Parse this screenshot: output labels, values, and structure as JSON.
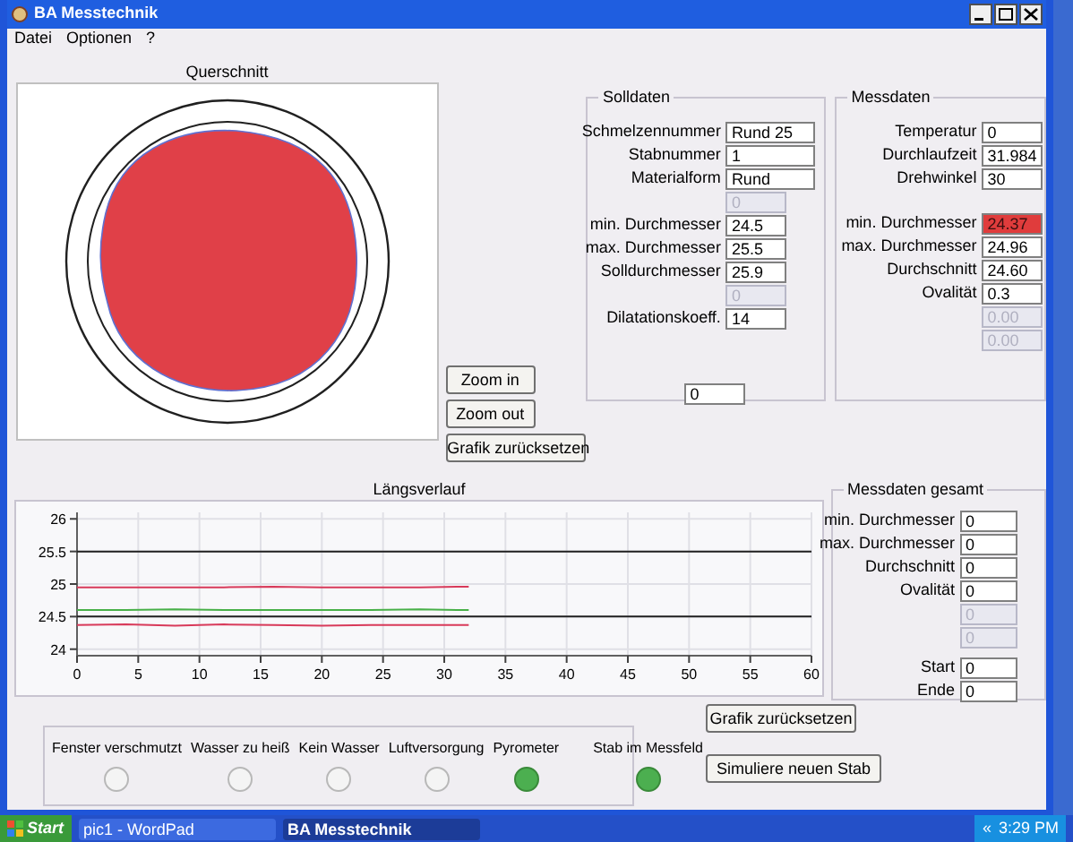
{
  "window": {
    "title": "BA Messtechnik"
  },
  "menu": [
    "Datei",
    "Optionen",
    "?"
  ],
  "cross_section": {
    "title": "Querschnitt"
  },
  "view_buttons": [
    "Zoom in",
    "Zoom out",
    "Grafik zurücksetzen"
  ],
  "solldaten": {
    "title": "Solldaten",
    "rows": [
      {
        "label": "Schmelzennummer",
        "value": "Rund 25",
        "disabled": false
      },
      {
        "label": "Stabnummer",
        "value": "1",
        "disabled": false
      },
      {
        "label": "Materialform",
        "value": "Rund",
        "disabled": false
      },
      {
        "value": "0",
        "disabled": true
      },
      {
        "label": "min. Durchmesser",
        "value": "24.5",
        "disabled": false
      },
      {
        "label": "max. Durchmesser",
        "value": "25.5",
        "disabled": false
      },
      {
        "label": "Solldurchmesser",
        "value": "25.9",
        "disabled": false
      },
      {
        "value": "0",
        "disabled": true
      },
      {
        "label": "Dilatationskoeff.",
        "value": "14",
        "disabled": false
      }
    ],
    "counter": "0"
  },
  "messdaten": {
    "title": "Messdaten",
    "sections": [
      [
        {
          "label": "Temperatur",
          "value": "0",
          "disabled": false,
          "alarm": false
        },
        {
          "label": "Durchlaufzeit",
          "value": "31.984",
          "disabled": false,
          "alarm": false
        },
        {
          "label": "Drehwinkel",
          "value": "30",
          "disabled": false,
          "alarm": false
        }
      ],
      [
        {
          "label": "min. Durchmesser",
          "value": "24.37",
          "disabled": false,
          "alarm": true
        },
        {
          "label": "max. Durchmesser",
          "value": "24.96",
          "disabled": false,
          "alarm": false
        },
        {
          "label": "Durchschnitt",
          "value": "24.60",
          "disabled": false,
          "alarm": false
        },
        {
          "label": "Ovalität",
          "value": "0.3",
          "disabled": false,
          "alarm": false
        },
        {
          "value": "0.00",
          "disabled": true,
          "alarm": false
        },
        {
          "value": "0.00",
          "disabled": true,
          "alarm": false
        }
      ]
    ]
  },
  "profile": {
    "title": "Längsverlauf",
    "chart_data": {
      "type": "line",
      "grid": true,
      "x": [
        0,
        4,
        8,
        12,
        16,
        20,
        24,
        28,
        32,
        36,
        40,
        44,
        48,
        52,
        56,
        60
      ],
      "xlim": [
        0,
        60
      ],
      "ylim": [
        23.9,
        26.1
      ],
      "xticks": [
        0,
        5,
        10,
        15,
        20,
        25,
        30,
        35,
        40,
        45,
        50,
        55,
        60
      ],
      "yticks": [
        24,
        24.5,
        25,
        25.5,
        26
      ],
      "series": [
        {
          "color": "#d83a5a",
          "values": [
            24.95,
            24.95,
            24.95,
            24.95,
            24.96,
            24.95,
            24.95,
            24.95,
            24.96,
            null,
            null,
            null,
            null,
            null,
            null,
            null
          ]
        },
        {
          "color": "#48b048",
          "values": [
            24.6,
            24.6,
            24.61,
            24.6,
            24.6,
            24.6,
            24.6,
            24.61,
            24.6,
            null,
            null,
            null,
            null,
            null,
            null,
            null
          ]
        },
        {
          "color": "#d83a5a",
          "values": [
            24.37,
            24.38,
            24.36,
            24.38,
            24.37,
            24.36,
            24.37,
            24.37,
            24.37,
            null,
            null,
            null,
            null,
            null,
            null,
            null
          ]
        },
        {
          "color": "#202020",
          "values": [
            25.5,
            25.5,
            25.5,
            25.5,
            25.5,
            25.5,
            25.5,
            25.5,
            25.5,
            25.5,
            25.5,
            25.5,
            25.5,
            25.5,
            25.5,
            25.5
          ]
        },
        {
          "color": "#202020",
          "values": [
            24.5,
            24.5,
            24.5,
            24.5,
            24.5,
            24.5,
            24.5,
            24.5,
            24.5,
            24.5,
            24.5,
            24.5,
            24.5,
            24.5,
            24.5,
            24.5
          ]
        }
      ]
    }
  },
  "messdaten_gesamt": {
    "title": "Messdaten gesamt",
    "sections": [
      [
        {
          "label": "min. Durchmesser",
          "value": "0",
          "disabled": false
        },
        {
          "label": "max. Durchmesser",
          "value": "0",
          "disabled": false
        },
        {
          "label": "Durchschnitt",
          "value": "0",
          "disabled": false
        },
        {
          "label": "Ovalität",
          "value": "0",
          "disabled": false
        },
        {
          "value": "0",
          "disabled": true
        },
        {
          "value": "0",
          "disabled": true
        }
      ],
      [
        {
          "label": "Start",
          "value": "0",
          "disabled": false
        },
        {
          "label": "Ende",
          "value": "0",
          "disabled": false
        }
      ]
    ]
  },
  "reset_button": "Grafik zurücksetzen",
  "indicators": [
    {
      "label": "Fenster verschmutzt",
      "on": false
    },
    {
      "label": "Wasser zu heiß",
      "on": false
    },
    {
      "label": "Kein Wasser",
      "on": false
    },
    {
      "label": "Luftversorgung",
      "on": false
    },
    {
      "label": "Pyrometer",
      "on": true
    }
  ],
  "bar_indicator": {
    "label": "Stab im Messfeld",
    "on": true
  },
  "simulate_button": "Simuliere neuen Stab",
  "taskbar": {
    "start": "Start",
    "tasks": [
      {
        "label": "pic1 - WordPad",
        "selected": false
      },
      {
        "label": "BA Messtechnik",
        "selected": true
      }
    ],
    "tray_toggle": "«",
    "time": "3:29 PM"
  }
}
